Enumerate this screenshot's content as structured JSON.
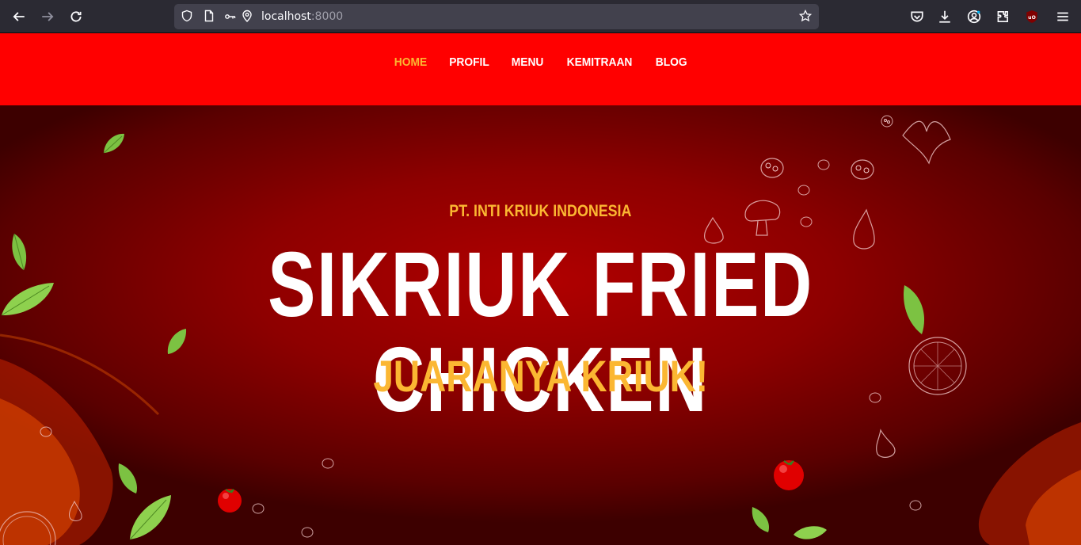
{
  "browser": {
    "url_host": "localhost",
    "url_port": ":8000"
  },
  "nav": {
    "items": [
      {
        "label": "HOME",
        "active": true
      },
      {
        "label": "PROFIL",
        "active": false
      },
      {
        "label": "MENU",
        "active": false
      },
      {
        "label": "KEMITRAAN",
        "active": false
      },
      {
        "label": "BLOG",
        "active": false
      }
    ]
  },
  "hero": {
    "company": "PT. INTI KRIUK INDONESIA",
    "title": "SIKRIUK FRIED CHICKEN",
    "tagline": "JUARANYA KRIUK!"
  },
  "colors": {
    "header_bg": "#ff0000",
    "accent": "#fbb732",
    "hero_bg": "#8e0000",
    "text": "#ffffff"
  }
}
